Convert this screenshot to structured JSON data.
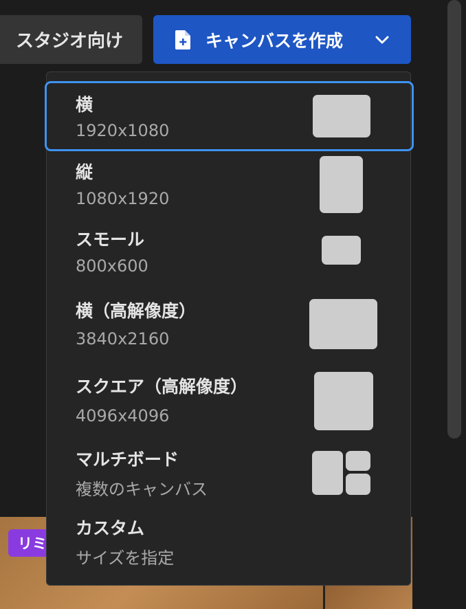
{
  "toolbar": {
    "studio_label": "スタジオ向け",
    "create_label": "キャンバスを作成"
  },
  "menu": {
    "items": [
      {
        "title": "横",
        "sub": "1920x1080"
      },
      {
        "title": "縦",
        "sub": "1080x1920"
      },
      {
        "title": "スモール",
        "sub": "800x600"
      },
      {
        "title": "横（高解像度）",
        "sub": "3840x2160"
      },
      {
        "title": "スクエア（高解像度）",
        "sub": "4096x4096"
      },
      {
        "title": "マルチボード",
        "sub": "複数のキャンバス"
      },
      {
        "title": "カスタム",
        "sub": "サイズを指定"
      }
    ]
  },
  "background": {
    "badge_label": "リミ"
  },
  "colors": {
    "accent": "#1e56c4",
    "selection": "#3f93f2",
    "badge": "#8a3be0"
  }
}
